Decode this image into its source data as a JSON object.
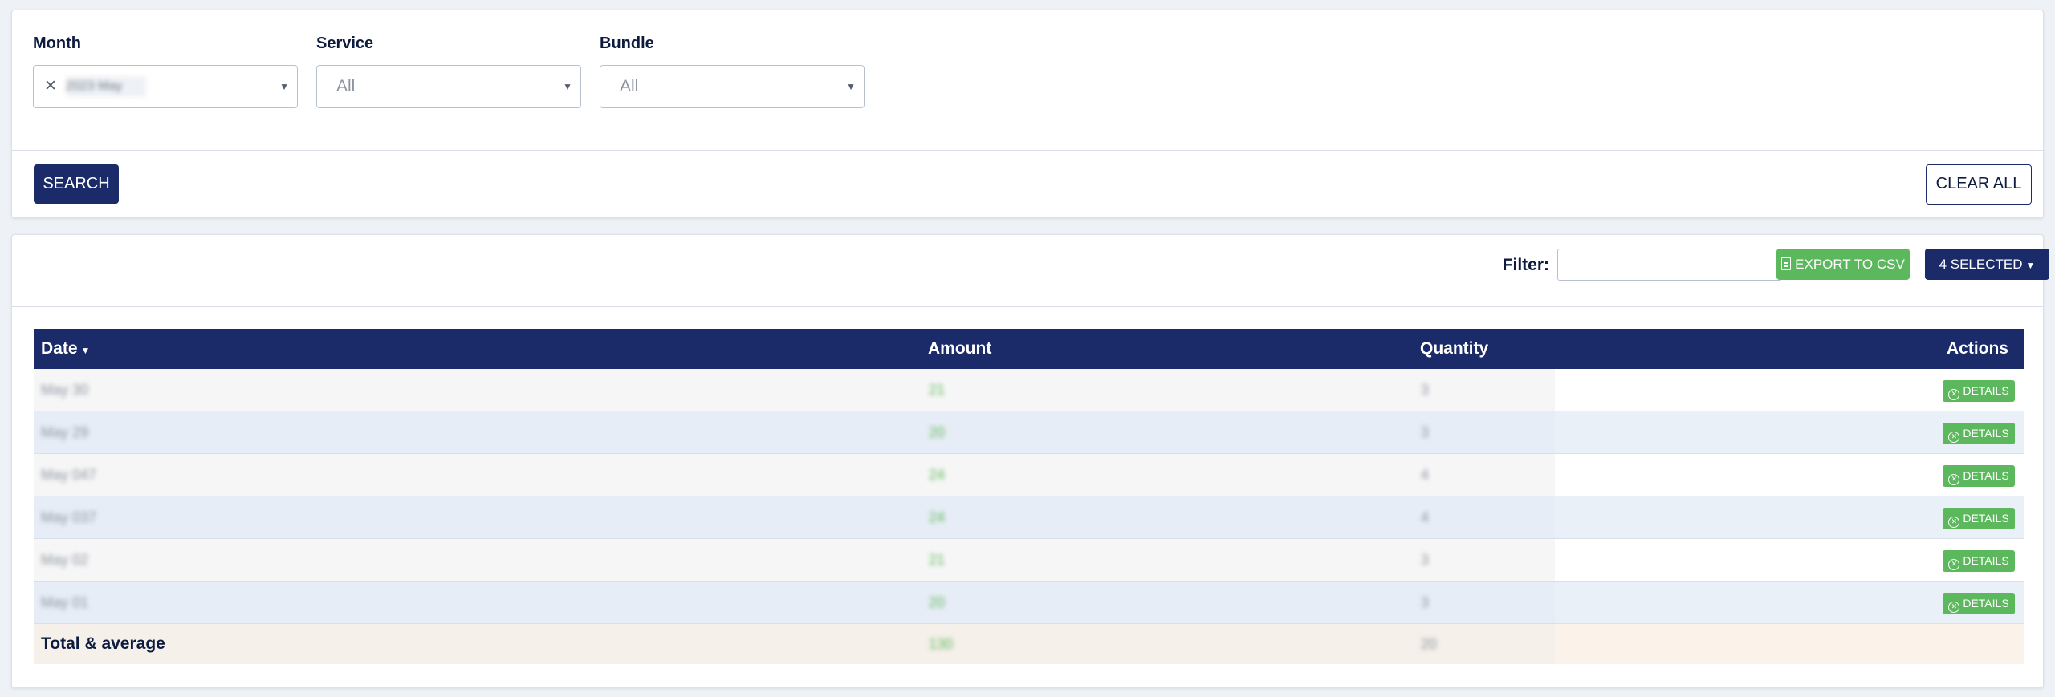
{
  "search": {
    "fields": [
      {
        "label": "Month",
        "value": "2023 May",
        "has_clear": true
      },
      {
        "label": "Service",
        "value": "All",
        "has_clear": false
      },
      {
        "label": "Bundle",
        "value": "All",
        "has_clear": false
      }
    ],
    "search_label": "SEARCH",
    "clear_label": "CLEAR ALL"
  },
  "results": {
    "filter_label": "Filter:",
    "filter_value": "",
    "export_label": "EXPORT TO CSV",
    "selected_label": "4 SELECTED",
    "columns": {
      "date": "Date",
      "amount": "Amount",
      "quantity": "Quantity",
      "actions": "Actions"
    },
    "rows": [
      {
        "date": "May 30",
        "amount": "21",
        "quantity": "3",
        "action": "DETAILS"
      },
      {
        "date": "May 29",
        "amount": "20",
        "quantity": "3",
        "action": "DETAILS"
      },
      {
        "date": "May 047",
        "amount": "24",
        "quantity": "4",
        "action": "DETAILS"
      },
      {
        "date": "May 037",
        "amount": "24",
        "quantity": "4",
        "action": "DETAILS"
      },
      {
        "date": "May 02",
        "amount": "21",
        "quantity": "3",
        "action": "DETAILS"
      },
      {
        "date": "May 01",
        "amount": "20",
        "quantity": "3",
        "action": "DETAILS"
      }
    ],
    "total": {
      "label": "Total & average",
      "amount": "130",
      "quantity": "20"
    }
  },
  "colors": {
    "navy": "#1b2a68",
    "green": "#5cb85c",
    "background": "#eef2f6",
    "total_row": "#fbf3ea"
  }
}
